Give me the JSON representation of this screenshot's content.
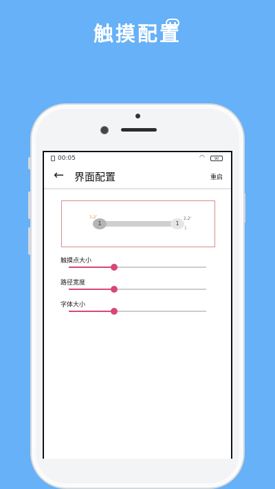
{
  "header": {
    "title": "触摸配置"
  },
  "status_bar": {
    "time": "00:05",
    "battery": "90"
  },
  "toolbar": {
    "back_icon": "arrow-left-icon",
    "title": "界面配置",
    "reset_label": "重启"
  },
  "preview": {
    "left_node": "1",
    "right_node": "1",
    "left_label": "1,2'",
    "right_label": "2,2'",
    "right_sub": "1"
  },
  "settings": [
    {
      "label": "触摸点大小",
      "value": 0.33
    },
    {
      "label": "路径宽度",
      "value": 0.33
    },
    {
      "label": "字体大小",
      "value": 0.33
    }
  ],
  "colors": {
    "background": "#66b1f7",
    "accent": "#d8467a"
  }
}
